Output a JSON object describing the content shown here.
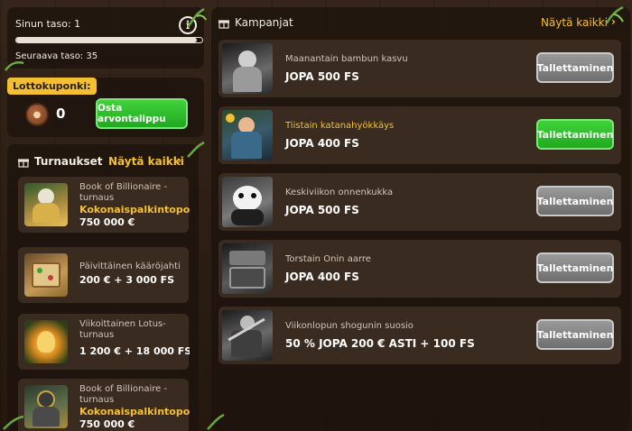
{
  "level": {
    "current_label": "Sinun taso: 1",
    "next_label": "Seuraava taso: 35",
    "progress": 0.97,
    "info_glyph": "i"
  },
  "lotto": {
    "tag": "Lottokuponki:",
    "count": "0",
    "buy_label": "Osta arvontalippu"
  },
  "tournaments": {
    "title": "Turnaukset",
    "see_all": "Näytä kaikki",
    "items": [
      {
        "name": "Book of Billionaire - turnaus",
        "prize_line": "Kokonaispalkintopott",
        "amount": "750 000 €"
      },
      {
        "name": "Päivittäinen kääröjahti",
        "prize_line": "",
        "amount": "200 € + 3 000 FS"
      },
      {
        "name": "Viikoittainen Lotus-turnaus",
        "prize_line": "",
        "amount": "1 200 € + 18 000 FS"
      },
      {
        "name": "Book of Billionaire - turnaus",
        "prize_line": "Kokonaispalkintopott",
        "amount": "750 000 €"
      }
    ]
  },
  "campaigns": {
    "title": "Kampanjat",
    "see_all": "Näytä kaikki",
    "items": [
      {
        "name": "Maanantain bambun kasvu",
        "offer": "JOPA 500 FS",
        "button": "Tallettaminen",
        "active": false
      },
      {
        "name": "Tiistain katanahyökkäys",
        "offer": "JOPA 400 FS",
        "button": "Tallettaminen",
        "active": true
      },
      {
        "name": "Keskiviikon onnenkukka",
        "offer": "JOPA 500 FS",
        "button": "Tallettaminen",
        "active": false
      },
      {
        "name": "Torstain Onin aarre",
        "offer": "JOPA 400 FS",
        "button": "Tallettaminen",
        "active": false
      },
      {
        "name": "Viikonlopun shogunin suosio",
        "offer": "50 % JOPA 200 € ASTI + 100 FS",
        "button": "Tallettaminen",
        "active": false
      }
    ]
  },
  "colors": {
    "accent_yellow": "#f3c033",
    "button_green": "#2bbf28",
    "button_grey": "#8a8a8a",
    "panel_bg": "#1c130d",
    "card_bg": "#3a2b20"
  },
  "icons": {
    "info": "info-icon",
    "gift": "gift-icon",
    "chevron": "chevron-right-icon",
    "coin": "coupon-coin-icon",
    "vine": "bamboo-vine-icon"
  }
}
